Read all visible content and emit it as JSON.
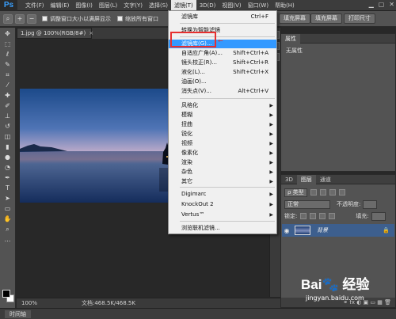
{
  "app": {
    "logo": "Ps"
  },
  "menubar": {
    "items": [
      "文件(F)",
      "编辑(E)",
      "图像(I)",
      "图层(L)",
      "文字(Y)",
      "选择(S)",
      "滤镜(T)",
      "3D(D)",
      "视图(V)",
      "窗口(W)",
      "帮助(H)"
    ],
    "active_index": 6
  },
  "optbar": {
    "resize_windows_label": "调整窗口大小以满屏显示",
    "zoom_all_label": "缩放所有窗口",
    "fill_screen_label": "填充屏幕",
    "print_size_label": "打印尺寸"
  },
  "document": {
    "tab_title": "1.jpg @ 100%(RGB/8#)",
    "close": "×",
    "zoom": "100%",
    "doc_info": "文档:468.5K/468.5K"
  },
  "timeline": {
    "label": "时间轴"
  },
  "filter_menu": {
    "last_filter": {
      "label": "滤镜库",
      "shortcut": "Ctrl+F"
    },
    "smart_filter": {
      "label": "转换为智能滤镜"
    },
    "filter_gallery": {
      "label": "滤镜库(G)..."
    },
    "adaptive_wide": {
      "label": "自适应广角(A)...",
      "shortcut": "Shift+Ctrl+A"
    },
    "camera_raw": {
      "label": "镜头校正(R)...",
      "shortcut": "Shift+Ctrl+R"
    },
    "liquify": {
      "label": "液化(L)...",
      "shortcut": "Shift+Ctrl+X"
    },
    "oil_paint": {
      "label": "油画(O)..."
    },
    "vanishing_point": {
      "label": "消失点(V)...",
      "shortcut": "Alt+Ctrl+V"
    },
    "submenus": [
      "风格化",
      "模糊",
      "扭曲",
      "锐化",
      "视频",
      "像素化",
      "渲染",
      "杂色",
      "其它"
    ],
    "plugins": [
      "Digimarc",
      "KnockOut 2",
      "Vertus™"
    ],
    "browse_online": {
      "label": "浏览联机滤镜..."
    }
  },
  "properties_panel": {
    "tab": "属性",
    "no_props": "无属性"
  },
  "layers_panel": {
    "tabs": [
      "3D",
      "图层",
      "通道"
    ],
    "kind_label": "ρ 类型",
    "blend_mode": "正常",
    "opacity_label": "不透明度:",
    "lock_label": "锁定:",
    "fill_label": "填充:",
    "layer_name": "背景",
    "footer_icons": "⚭ fx ◐ ▣ ▭ ▦ 🗑"
  },
  "watermark": {
    "main": "Bai🐾 经验",
    "sub": "jingyan.baidu.com"
  },
  "colors": {
    "highlight": "#3399ff",
    "annotation_red": "#e63030",
    "layer_selected": "#3d5f8e"
  }
}
